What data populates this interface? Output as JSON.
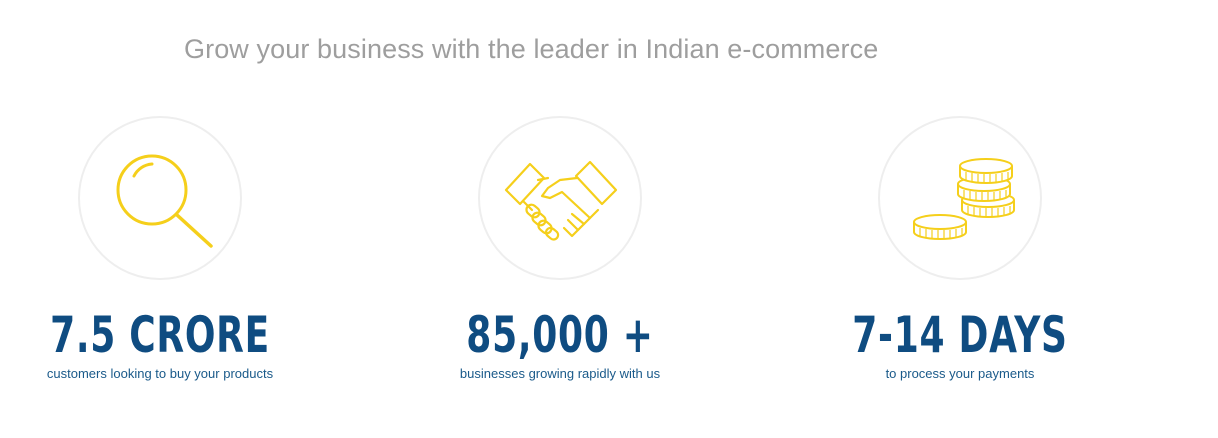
{
  "headline": "Grow your business with the leader in Indian e-commerce",
  "colors": {
    "icon": "#f5cf1b",
    "value": "#0f4c81",
    "label": "#1a5a8a",
    "headline": "#9e9e9e",
    "circle_border": "#eeeeee"
  },
  "stats": [
    {
      "icon": "magnifying-glass-icon",
      "value": "7.5 CRORE",
      "label": "customers looking to buy your products"
    },
    {
      "icon": "handshake-icon",
      "value": "85,000 +",
      "label": "businesses growing rapidly with us"
    },
    {
      "icon": "coins-icon",
      "value": "7-14 DAYS",
      "label": "to process your payments"
    }
  ]
}
